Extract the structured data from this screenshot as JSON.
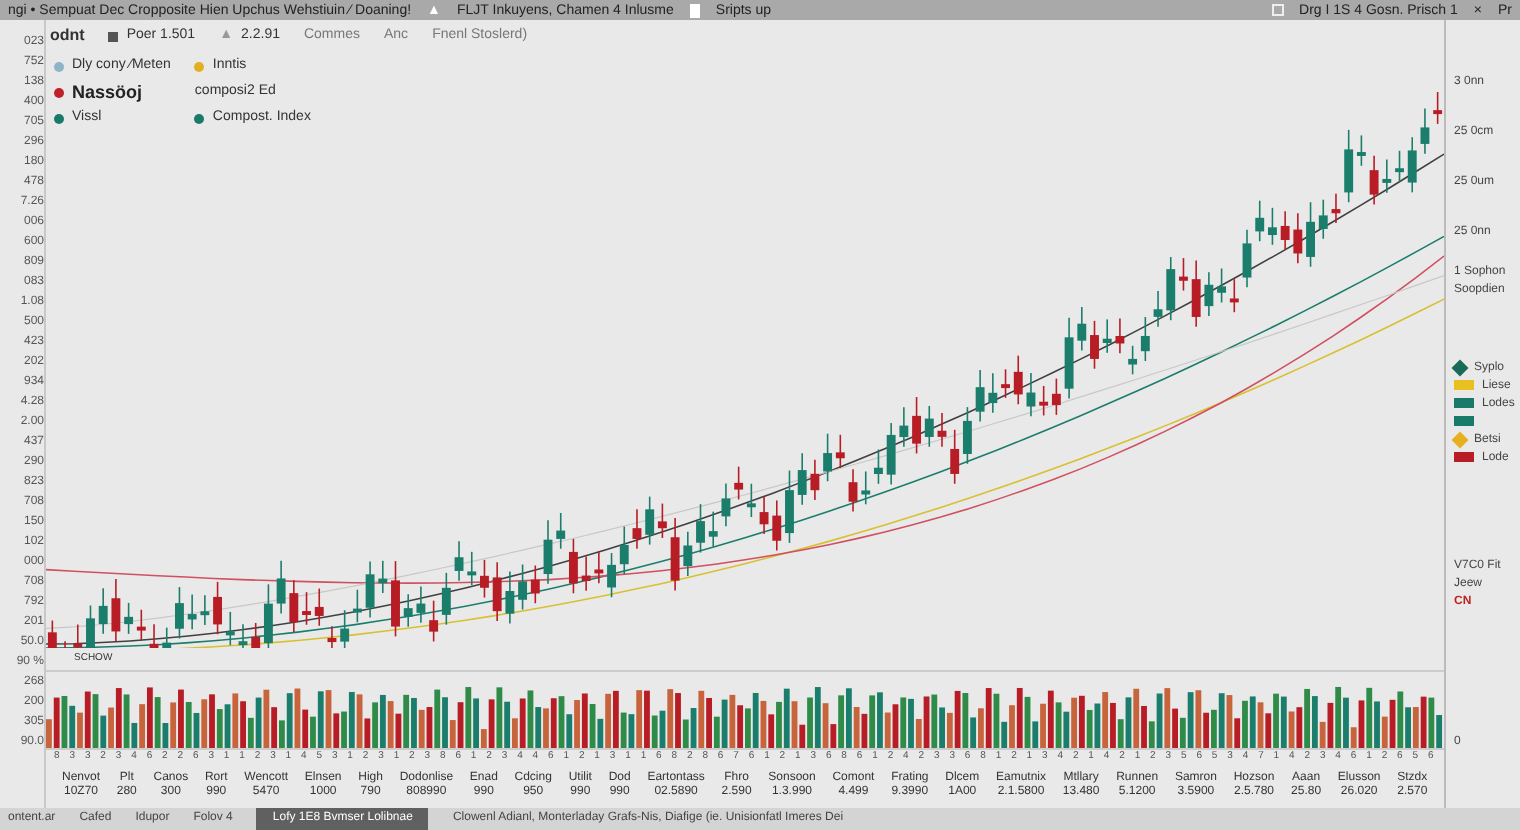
{
  "top_bar": {
    "left": "ngi • Sempuat  Dec  Cropposite Hien Upchus Wehstiuin ⁄ Doaning!",
    "middle": "FLJT Inkuyens, Chamen 4 Inlusme",
    "warning": "▲",
    "doc": "Sripts up",
    "right": "Drg I 1S 4 Gosn. Prisch 1",
    "close": "×",
    "far": "Pr"
  },
  "header": {
    "title": "odnt",
    "stat_1": "Poer 1.501",
    "triangle": "▲",
    "stat_2": "2.2.91",
    "link_1": "Commes",
    "link_2": "Anc",
    "link_3": "Fnenl Stoslerd)"
  },
  "legend": [
    {
      "label": "Dly cony ⁄Meten",
      "color": "#8fb4c8",
      "emphasis": false
    },
    {
      "label": "Inntis",
      "color": "#e0b020",
      "emphasis": false
    },
    {
      "label": "Nassöoj",
      "color": "#c0202a",
      "emphasis": true
    },
    {
      "label": "composi2 Ed",
      "emphasis": false
    },
    {
      "label": "Vissl",
      "color": "#1a7a6a",
      "emphasis": false
    },
    {
      "label": "Compost. Index",
      "color": "#1a7a6a",
      "emphasis": false
    }
  ],
  "left_axis": [
    "023",
    "752",
    "138",
    "400",
    "705",
    "296",
    "180",
    "478",
    "7.26",
    "006",
    "600",
    "809",
    "083",
    "1.08",
    "500",
    "423",
    "202",
    "934",
    "4.28",
    "2.00",
    "437",
    "290",
    "823",
    "708",
    "150",
    "102",
    "000",
    "708",
    "792",
    "201",
    "50.0",
    "90 %",
    "268",
    "200",
    "305",
    "90.0"
  ],
  "right_axis": [
    "3 0nn",
    "25 0cm",
    "25 0um",
    "25 0nn"
  ],
  "right_notes": [
    "1 Sophon",
    "Soopdien"
  ],
  "right_legend": [
    {
      "label": "Syplo",
      "color": "#1a6a5a",
      "kind": "diamond"
    },
    {
      "label": "Liese",
      "color": "#e8c020",
      "kind": "bar"
    },
    {
      "label": "Lodes",
      "color": "#1a7a6a",
      "kind": "bar"
    },
    {
      "color": "#1a7a6a",
      "kind": "bar"
    },
    {
      "label": "Betsi",
      "color": "#e8b020",
      "kind": "diamond"
    },
    {
      "label": "Lode",
      "color": "#b81c24",
      "kind": "bar"
    }
  ],
  "volume_panel": {
    "title": "V7C0 Fit",
    "sub": "Jeew",
    "badge": "CN",
    "zero": "0",
    "label": "SCHOW"
  },
  "volume_digits": [
    "8",
    "3",
    "3",
    "2",
    "3",
    "4",
    "6",
    "2",
    "2",
    "6",
    "3",
    "1",
    "1",
    "2",
    "3",
    "1",
    "4",
    "5",
    "3",
    "1",
    "2",
    "3",
    "1",
    "2",
    "3",
    "8",
    "6",
    "1",
    "2",
    "3",
    "4",
    "4",
    "6",
    "1",
    "2",
    "1",
    "3",
    "1",
    "1",
    "6",
    "8",
    "2",
    "8",
    "6",
    "7",
    "6",
    "1",
    "2",
    "1",
    "3",
    "6",
    "8",
    "6",
    "1",
    "2",
    "4",
    "2",
    "3",
    "3",
    "6",
    "8",
    "1",
    "2",
    "1",
    "3",
    "4",
    "2",
    "1",
    "4",
    "2",
    "1",
    "2",
    "3",
    "5",
    "6",
    "5",
    "3",
    "4",
    "7",
    "1",
    "4",
    "2",
    "3",
    "4",
    "6",
    "1",
    "2",
    "6",
    "5",
    "6"
  ],
  "x_labels": [
    {
      "name": "Nenvot",
      "value": "10Z70"
    },
    {
      "name": "Plt",
      "value": "280"
    },
    {
      "name": "Canos",
      "value": "300"
    },
    {
      "name": "Rort",
      "value": "990"
    },
    {
      "name": "Wencott",
      "value": "5470"
    },
    {
      "name": "Elnsen",
      "value": "1000"
    },
    {
      "name": "High",
      "value": "790"
    },
    {
      "name": "Dodonlise",
      "value": "808990"
    },
    {
      "name": "Enad",
      "value": "990"
    },
    {
      "name": "Cdcing",
      "value": "950"
    },
    {
      "name": "Utilit",
      "value": "990"
    },
    {
      "name": "Dod",
      "value": "990"
    },
    {
      "name": "Eartontass",
      "value": "02.5890"
    },
    {
      "name": "Fhro",
      "value": "2.590"
    },
    {
      "name": "Sonsoon",
      "value": "1.3.990"
    },
    {
      "name": "Comont",
      "value": "4.499"
    },
    {
      "name": "Frating",
      "value": "9.3990"
    },
    {
      "name": "Dlcem",
      "value": "1A00"
    },
    {
      "name": "Eamutnix",
      "value": "2.1.5800"
    },
    {
      "name": "Mtllary",
      "value": "13.480"
    },
    {
      "name": "Runnen",
      "value": "5.1200"
    },
    {
      "name": "Samron",
      "value": "3.5900"
    },
    {
      "name": "Hozson",
      "value": "2.5.780"
    },
    {
      "name": "Aaan",
      "value": "25.80"
    },
    {
      "name": "Elusson",
      "value": "26.020"
    },
    {
      "name": "Stzdx",
      "value": "2.570"
    }
  ],
  "status_bar": {
    "items": [
      {
        "label": "ontent.ar",
        "selected": false
      },
      {
        "label": "Cafed",
        "selected": false
      },
      {
        "label": "Idupor",
        "selected": false
      },
      {
        "label": "Folov 4",
        "selected": false
      },
      {
        "label": "Lofy 1E8 Bvmser Lolibnae",
        "selected": true
      },
      {
        "label": "Clowenl Adianl, Monterladay Grafs-Nis, Diafige (ie. Unisionfatl Imeres Dei",
        "selected": false
      }
    ]
  }
}
